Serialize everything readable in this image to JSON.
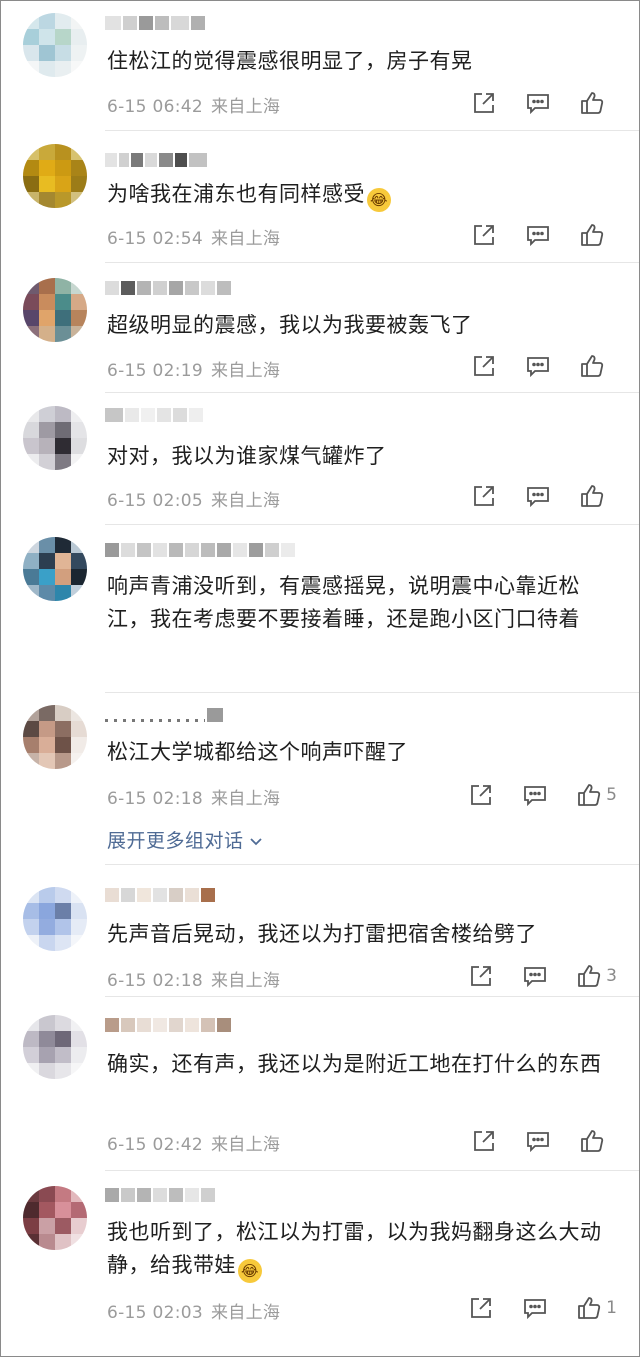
{
  "comments": [
    {
      "text": "住松江的觉得震感很明显了，房子有晃",
      "date": "6-15 06:42",
      "location": "来自上海",
      "likes": "",
      "emoji": ""
    },
    {
      "text": "为啥我在浦东也有同样感受",
      "date": "6-15 02:54",
      "location": "来自上海",
      "likes": "",
      "emoji": "😂"
    },
    {
      "text": "超级明显的震感，我以为我要被轰飞了",
      "date": "6-15 02:19",
      "location": "来自上海",
      "likes": "",
      "emoji": ""
    },
    {
      "text": "对对，我以为谁家煤气罐炸了",
      "date": "6-15 02:05",
      "location": "来自上海",
      "likes": "",
      "emoji": ""
    },
    {
      "text": "响声青浦没听到，有震感摇晃，说明震中心靠近松江，我在考虑要不要接着睡，还是跑小区门口待着",
      "date": "",
      "location": "",
      "likes": "",
      "emoji": ""
    },
    {
      "text": "松江大学城都给这个响声吓醒了",
      "date": "6-15 02:18",
      "location": "来自上海",
      "likes": "5",
      "emoji": ""
    },
    {
      "text": "先声音后晃动，我还以为打雷把宿舍楼给劈了",
      "date": "6-15 02:18",
      "location": "来自上海",
      "likes": "3",
      "emoji": ""
    },
    {
      "text": "确实，还有声，我还以为是附近工地在打什么的东西",
      "date": "6-15 02:42",
      "location": "来自上海",
      "likes": "",
      "emoji": ""
    },
    {
      "text": "我也听到了，松江以为打雷，以为我妈翻身这么大动静，给我带娃",
      "date": "6-15 02:03",
      "location": "来自上海",
      "likes": "1",
      "emoji": "😂"
    }
  ],
  "expand_label": "展开更多组对话",
  "icons": {
    "share": "share-icon",
    "reply": "comment-icon",
    "like": "thumbs-up-icon",
    "expand": "chevron-down-icon",
    "emoji": "laughing-emoji"
  },
  "colors": {
    "text": "#1f1f1f",
    "meta": "#9b9b9b",
    "link": "#4f6b95",
    "divider": "#e6e6e6"
  }
}
